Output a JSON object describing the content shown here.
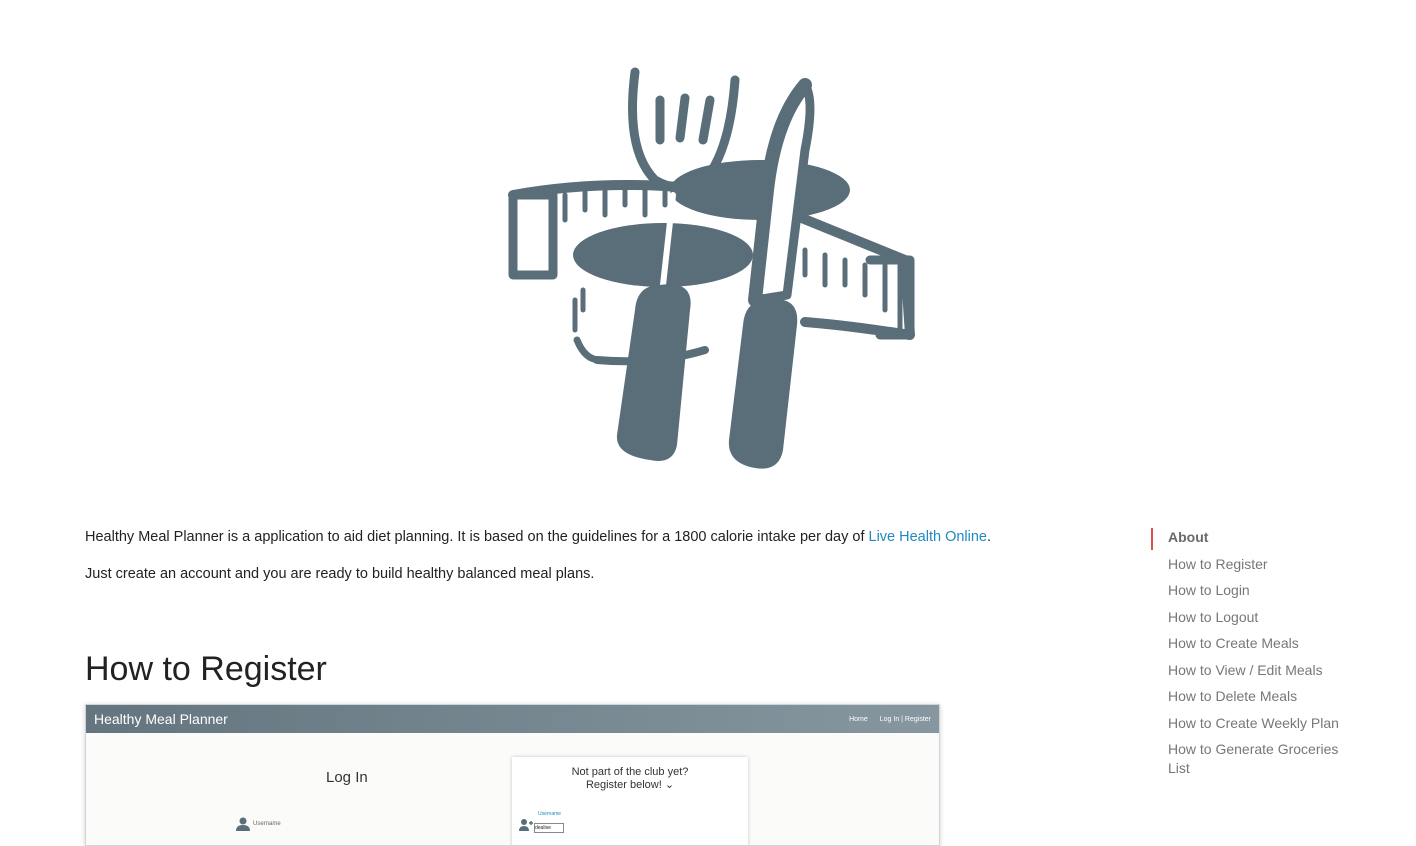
{
  "intro": {
    "text_before_link": "Healthy Meal Planner is a application to aid diet planning. It is based on the guidelines for a 1800 calorie intake per day of ",
    "link_text": "Live Health Online",
    "text_after_link": ".",
    "line2": "Just create an account and you are ready to build healthy balanced meal plans."
  },
  "section": {
    "title": "How to Register"
  },
  "screenshot": {
    "brand": "Healthy Meal Planner",
    "nav_home": "Home",
    "nav_login_register": "Log In | Register",
    "login_title": "Log In",
    "register_line1": "Not part of the club yet?",
    "register_line2": "Register below!",
    "register_chevron": "⌄",
    "username_label": "Username",
    "reg_username_label": "Username",
    "reg_username_value": "dealise"
  },
  "toc": {
    "items": [
      {
        "label": "About",
        "active": true
      },
      {
        "label": "How to Register"
      },
      {
        "label": "How to Login"
      },
      {
        "label": "How to Logout"
      },
      {
        "label": "How to Create Meals"
      },
      {
        "label": "How to View / Edit Meals"
      },
      {
        "label": "How to Delete Meals"
      },
      {
        "label": "How to Create Weekly Plan"
      },
      {
        "label": "How to Generate Groceries List"
      }
    ]
  },
  "colors": {
    "logo": "#596e79",
    "link": "#1f8ac0",
    "active_marker": "#d9534f"
  },
  "icons": {
    "logo": "fork-knife-measuring-tape-icon",
    "user": "user-icon",
    "add_user": "add-user-icon"
  }
}
